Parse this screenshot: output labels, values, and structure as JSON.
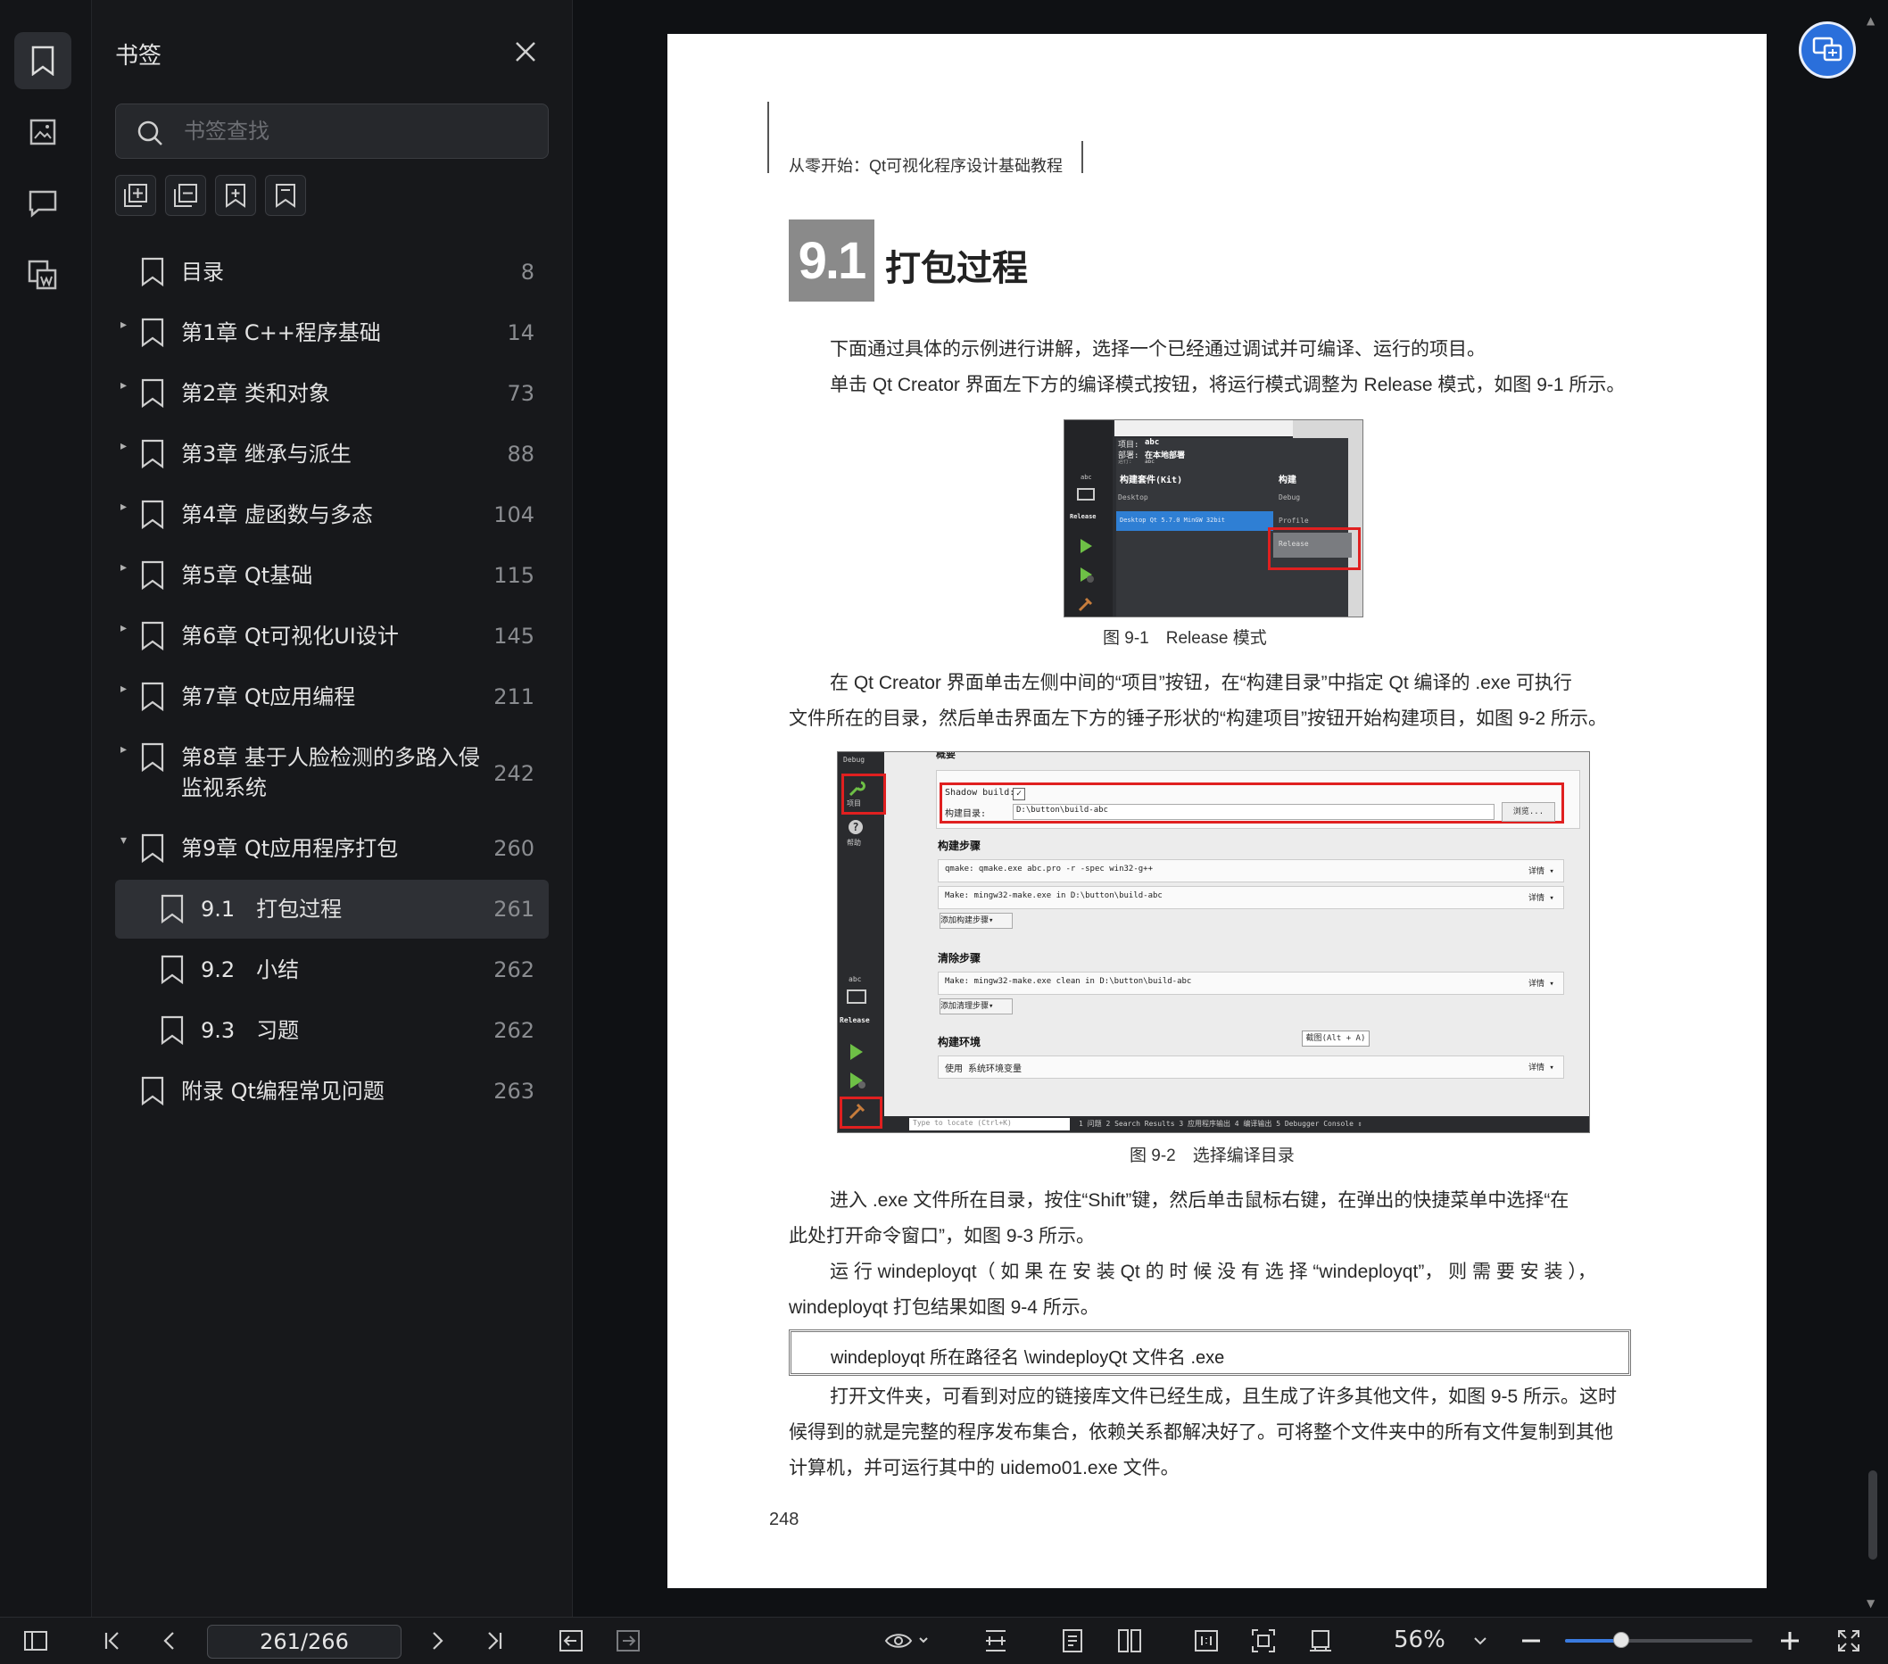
{
  "sidebar": {
    "title": "书签",
    "search_placeholder": "书签查找",
    "items": [
      {
        "label": "目录",
        "page": "8",
        "level": 0,
        "expander": ""
      },
      {
        "label": "第1章 C++程序基础",
        "page": "14",
        "level": 0,
        "expander": "▸"
      },
      {
        "label": "第2章 类和对象",
        "page": "73",
        "level": 0,
        "expander": "▸"
      },
      {
        "label": "第3章 继承与派生",
        "page": "88",
        "level": 0,
        "expander": "▸"
      },
      {
        "label": "第4章 虚函数与多态",
        "page": "104",
        "level": 0,
        "expander": "▸"
      },
      {
        "label": "第5章 Qt基础",
        "page": "115",
        "level": 0,
        "expander": "▸"
      },
      {
        "label": "第6章 Qt可视化UI设计",
        "page": "145",
        "level": 0,
        "expander": "▸"
      },
      {
        "label": "第7章 Qt应用编程",
        "page": "211",
        "level": 0,
        "expander": "▸"
      },
      {
        "label": "第8章 基于人脸检测的多路入侵",
        "label2": "监视系统",
        "page": "242",
        "level": 0,
        "expander": "▸"
      },
      {
        "label": "第9章 Qt应用程序打包",
        "page": "260",
        "level": 0,
        "expander": "▾"
      },
      {
        "label": "9.1　打包过程",
        "page": "261",
        "level": 1,
        "expander": "",
        "selected": true
      },
      {
        "label": "9.2　小结",
        "page": "262",
        "level": 1,
        "expander": ""
      },
      {
        "label": "9.3　习题",
        "page": "262",
        "level": 1,
        "expander": ""
      },
      {
        "label": "附录 Qt编程常见问题",
        "page": "263",
        "level": 0,
        "expander": ""
      }
    ]
  },
  "document": {
    "running_header": "从零开始：Qt可视化程序设计基础教程",
    "section_number": "9.1",
    "section_title": "打包过程",
    "paragraphs": [
      "下面通过具体的示例进行讲解，选择一个已经通过调试并可编译、运行的项目。",
      "单击 Qt Creator 界面左下方的编译模式按钮，将运行模式调整为 Release 模式，如图 9-1 所示。",
      "在 Qt Creator 界面单击左侧中间的“项目”按钮，在“构建目录”中指定 Qt 编译的 .exe 可执行",
      "文件所在的目录，然后单击界面左下方的锤子形状的“构建项目”按钮开始构建项目，如图 9-2 所示。",
      "进入 .exe 文件所在目录，按住“Shift”键，然后单击鼠标右键，在弹出的快捷菜单中选择“在",
      "此处打开命令窗口”，如图 9-3 所示。",
      "运 行 windeployqt（ 如 果 在 安 装 Qt 的 时 候 没 有 选 择 “windeployqt”， 则 需 要 安 装 ），",
      "windeployqt 打包结果如图 9-4 所示。",
      "打开文件夹，可看到对应的链接库文件已经生成，且生成了许多其他文件，如图 9-5 所示。这时",
      "候得到的就是完整的程序发布集合，依赖关系都解决好了。可将整个文件夹中的所有文件复制到其他",
      "计算机，并可运行其中的 uidemo01.exe 文件。"
    ],
    "figure1_caption": "图 9-1　Release 模式",
    "figure2_caption": "图 9-2　选择编译目录",
    "code_line": "windeployqt 所在路径名 \\windeployQt 文件名 .exe",
    "page_number": "248",
    "fig1": {
      "project_label": "项目:",
      "project_value": "abc",
      "deploy_label": "部署:",
      "deploy_value": "在本地部署",
      "run_label": "运行:",
      "run_value": "abc",
      "kit_header": "构建套件(Kit)",
      "build_header": "构建",
      "kit_desktop": "Desktop",
      "kit_selected": "Desktop Qt 5.7.0 MinGW 32bit",
      "build_debug": "Debug",
      "build_profile": "Profile",
      "build_release": "Release",
      "side_abc": "abc",
      "side_release": "Release"
    },
    "fig2": {
      "top_label": "概要",
      "side_debug": "Debug",
      "side_project": "项目",
      "side_help": "帮助",
      "side_abc": "abc",
      "side_release": "Release",
      "shadow_build": "Shadow build:",
      "shadow_check": "✓",
      "build_dir_label": "构建目录:",
      "build_dir_value": "D:\\button\\build-abc",
      "browse": "浏览...",
      "build_steps": "构建步骤",
      "qmake_step": "qmake: qmake.exe abc.pro -r -spec win32-g++",
      "make_step": "Make: mingw32-make.exe in D:\\button\\build-abc",
      "add_build_step": "添加构建步骤▾",
      "clean_steps": "清除步骤",
      "clean_step": "Make: mingw32-make.exe clean in D:\\button\\build-abc",
      "add_clean_step": "添加清理步骤▾",
      "build_env": "构建环境",
      "env_value": "使用 系统环境变量",
      "details": "详情 ▾",
      "screenshot_hint": "截图(Alt + A)",
      "locate_placeholder": "Type to locate (Ctrl+K)",
      "status_tabs": "1 问题   2 Search Results   3 应用程序输出   4 编译输出   5 Debugger Console   ⇕"
    }
  },
  "toolbar": {
    "page_indicator": "261/266",
    "zoom": "56%",
    "zoom_fraction": 0.3
  },
  "colors": {
    "accent": "#3a7be0",
    "fab": "#2a6fdb",
    "highlight_red": "#e02020"
  }
}
